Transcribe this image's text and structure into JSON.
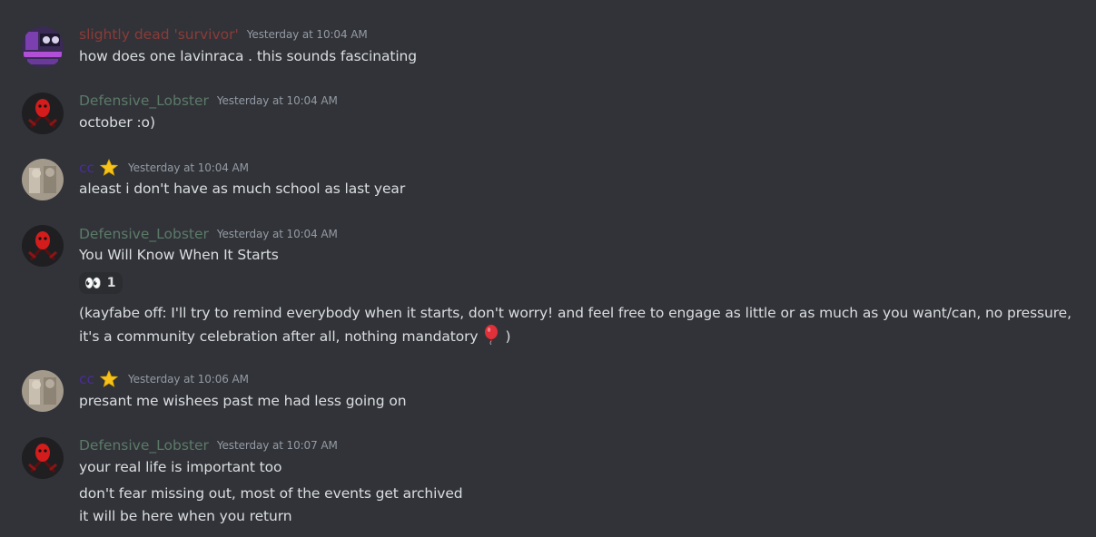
{
  "messages": [
    {
      "username": "slightly dead 'survivor'",
      "username_color": "#8a3b38",
      "timestamp": "Yesterday at 10:04 AM",
      "lines": [
        "how does one lavinraca . this sounds fascinating"
      ]
    },
    {
      "username": "Defensive_Lobster",
      "username_color": "#5c7a68",
      "timestamp": "Yesterday at 10:04 AM",
      "lines": [
        "october :o)"
      ]
    },
    {
      "username": "cc",
      "username_color": "#4a2d9a",
      "badge_icon": "star-icon",
      "timestamp": "Yesterday at 10:04 AM",
      "lines": [
        "aleast i don't have as much school as last year"
      ]
    },
    {
      "username": "Defensive_Lobster",
      "username_color": "#5c7a68",
      "timestamp": "Yesterday at 10:04 AM",
      "lines": [
        "You Will Know When It Starts"
      ],
      "reaction": {
        "emoji": "👀",
        "count": "1"
      },
      "followup": "(kayfabe off: I'll try to remind everybody when it starts, don't worry! and feel free to engage as little or as much as you want/can, no pressure, it's a community celebration after all, nothing mandatory",
      "followup_end": ")"
    },
    {
      "username": "cc",
      "username_color": "#4a2d9a",
      "badge_icon": "star-icon",
      "timestamp": "Yesterday at 10:06 AM",
      "lines": [
        "presant me wishees past me had less going on"
      ]
    },
    {
      "username": "Defensive_Lobster",
      "username_color": "#5c7a68",
      "timestamp": "Yesterday at 10:07 AM",
      "lines": [
        "your real life is important too",
        "don't fear missing out, most of the events get archived",
        "it will be here when you return"
      ]
    }
  ],
  "colors": {
    "background": "#313338",
    "text": "#dbdee1",
    "timestamp": "#949ba4"
  }
}
